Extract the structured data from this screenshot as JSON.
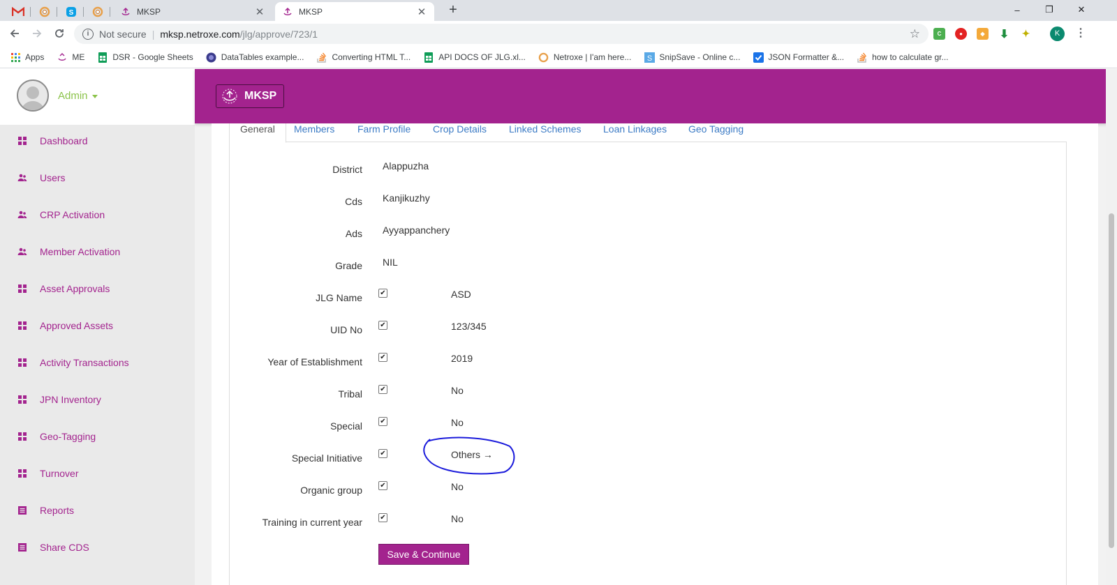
{
  "browser": {
    "tabs": [
      {
        "title": "MKSP",
        "active": false
      },
      {
        "title": "MKSP",
        "active": true
      }
    ],
    "new_tab_label": "+",
    "window_controls": {
      "minimize": "–",
      "restore": "❐",
      "close": "✕"
    },
    "address": {
      "security": "Not secure",
      "host": "mksp.netroxe.com",
      "path": "/jlg/approve/723/1"
    },
    "profile_initial": "K",
    "bookmarks": [
      {
        "label": "Apps",
        "icon": "apps-grid-icon"
      },
      {
        "label": "ME",
        "icon": "me-icon"
      },
      {
        "label": "DSR - Google Sheets",
        "icon": "sheets-icon"
      },
      {
        "label": "DataTables example...",
        "icon": "datatables-icon"
      },
      {
        "label": "Converting HTML T...",
        "icon": "stackoverflow-icon"
      },
      {
        "label": "API DOCS OF JLG.xl...",
        "icon": "sheets-icon"
      },
      {
        "label": "Netroxe | I'am here...",
        "icon": "netroxe-icon"
      },
      {
        "label": "SnipSave - Online c...",
        "icon": "snipsave-icon"
      },
      {
        "label": "JSON Formatter &...",
        "icon": "json-formatter-icon"
      },
      {
        "label": "how to calculate gr...",
        "icon": "stackoverflow-icon"
      }
    ]
  },
  "app": {
    "brand": "MKSP",
    "user": {
      "name": "Admin"
    },
    "sidebar": [
      {
        "label": "Dashboard",
        "icon": "grid-icon"
      },
      {
        "label": "Users",
        "icon": "users-icon"
      },
      {
        "label": "CRP Activation",
        "icon": "users-icon"
      },
      {
        "label": "Member Activation",
        "icon": "users-icon"
      },
      {
        "label": "Asset Approvals",
        "icon": "grid-icon"
      },
      {
        "label": "Approved Assets",
        "icon": "grid-icon"
      },
      {
        "label": "Activity Transactions",
        "icon": "grid-icon"
      },
      {
        "label": "JPN Inventory",
        "icon": "grid-icon"
      },
      {
        "label": "Geo-Tagging",
        "icon": "grid-icon"
      },
      {
        "label": "Turnover",
        "icon": "grid-icon"
      },
      {
        "label": "Reports",
        "icon": "list-icon"
      },
      {
        "label": "Share CDS",
        "icon": "list-icon"
      }
    ],
    "tabs": [
      "General",
      "Members",
      "Farm Profile",
      "Crop Details",
      "Linked Schemes",
      "Loan Linkages",
      "Geo Tagging"
    ],
    "active_tab": "General",
    "fields": [
      {
        "label": "District",
        "value": "Alappuzha"
      },
      {
        "label": "Cds",
        "value": "Kanjikuzhy"
      },
      {
        "label": "Ads",
        "value": "Ayyappanchery"
      },
      {
        "label": "Grade",
        "value": "NIL"
      }
    ],
    "checked_fields": [
      {
        "label": "JLG Name",
        "value": "ASD",
        "checked": true
      },
      {
        "label": "UID No",
        "value": "123/345",
        "checked": true
      },
      {
        "label": "Year of Establishment",
        "value": "2019",
        "checked": true
      },
      {
        "label": "Tribal",
        "value": "No",
        "checked": true
      },
      {
        "label": "Special",
        "value": "No",
        "checked": true
      },
      {
        "label": "Special Initiative",
        "value": "Others →",
        "checked": true
      },
      {
        "label": "Organic group",
        "value": "No",
        "checked": true
      },
      {
        "label": "Training in current year",
        "value": "No",
        "checked": true
      }
    ],
    "save_button": "Save & Continue"
  },
  "colors": {
    "brand_purple": "#a3238e",
    "sidebar_bg": "#eaeaea",
    "admin_green": "#8bc34a",
    "link_blue": "#3c7bc5",
    "annotation_blue": "#1a1adb"
  }
}
